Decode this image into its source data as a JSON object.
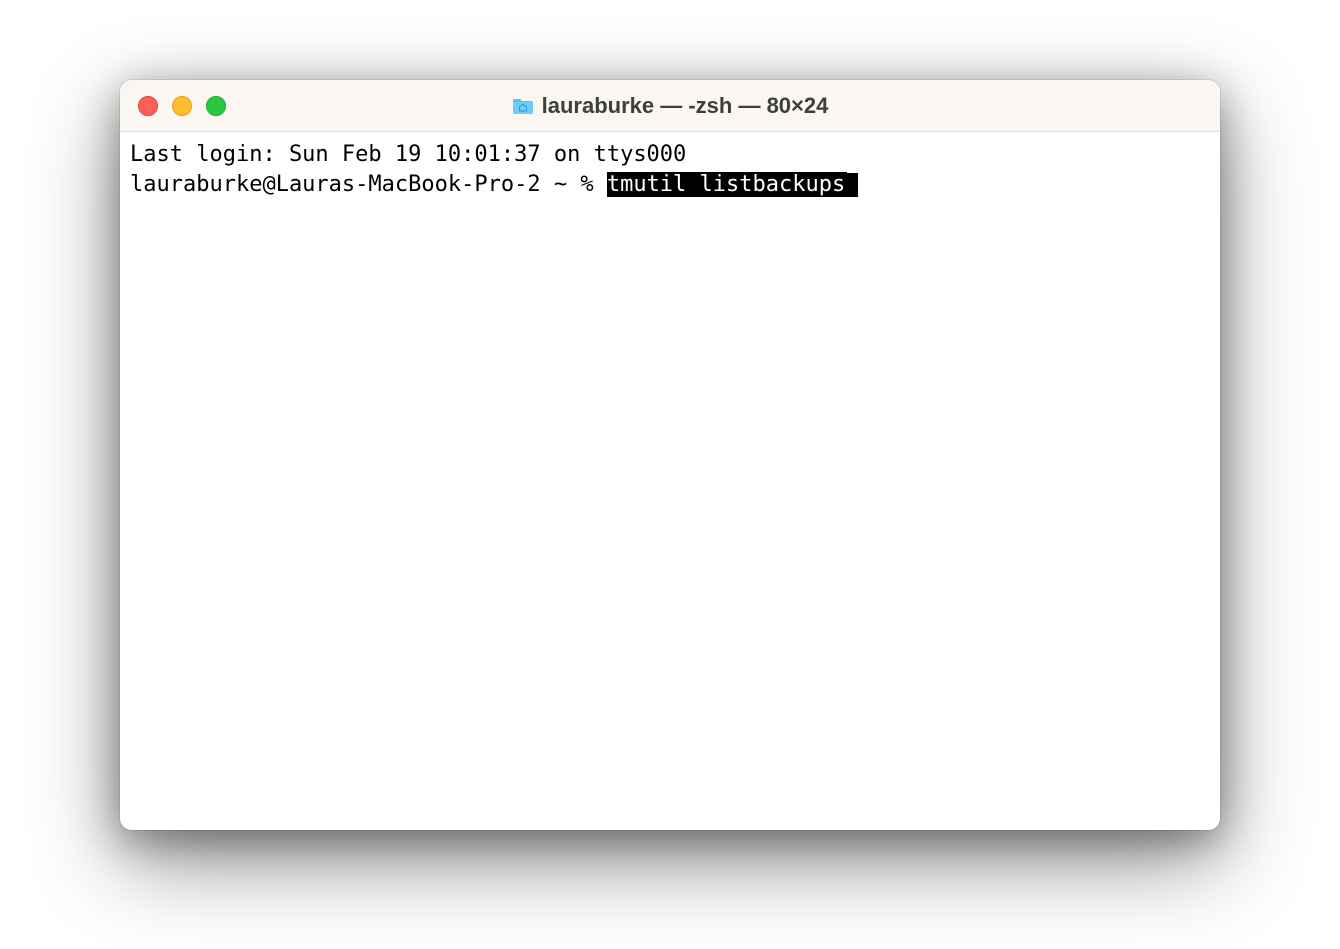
{
  "window": {
    "title": "lauraburke — -zsh — 80×24"
  },
  "terminal": {
    "last_login_line": "Last login: Sun Feb 19 10:01:37 on ttys000",
    "prompt": "lauraburke@Lauras-MacBook-Pro-2 ~ % ",
    "command_selected": "tmutil listbackups"
  }
}
